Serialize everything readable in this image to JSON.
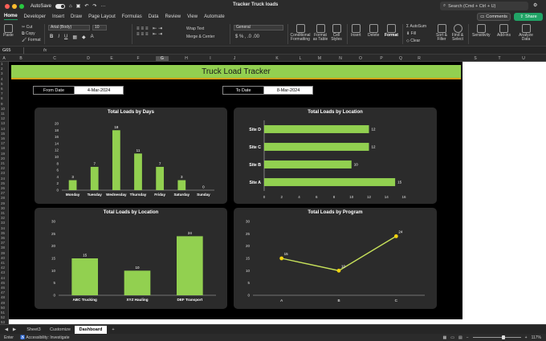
{
  "window": {
    "autosave_label": "AutoSave",
    "title": "Tracker Truck loads",
    "search_placeholder": "Search (Cmd + Ctrl + U)"
  },
  "menu_tabs": [
    "Home",
    "Developer",
    "Insert",
    "Draw",
    "Page Layout",
    "Formulas",
    "Data",
    "Review",
    "View",
    "Automate"
  ],
  "buttons": {
    "comments": "Comments",
    "share": "Share"
  },
  "ribbon": {
    "paste": "Paste",
    "cut": "Cut",
    "copy": "Copy",
    "format_painter": "Format",
    "font_name": "Arial (Body)",
    "font_size": "10",
    "wrap_text": "Wrap Text",
    "merge_center": "Merge & Center",
    "number_format": "General",
    "conditional_formatting": "Conditional Formatting",
    "format_as_table": "Format as Table",
    "cell_styles": "Cell Styles",
    "insert": "Insert",
    "delete": "Delete",
    "format": "Format",
    "autosum": "AutoSum",
    "fill": "Fill",
    "clear": "Clear",
    "sort_filter": "Sort & Filter",
    "find_select": "Find & Select",
    "sensitivity": "Sensitivity",
    "add_ins": "Add-ins",
    "analyze_data": "Analyze Data"
  },
  "formula_bar": {
    "name_box": "G65",
    "fx": "fx"
  },
  "columns": [
    "A",
    "B",
    "C",
    "D",
    "E",
    "F",
    "G",
    "H",
    "I",
    "J",
    "K",
    "L",
    "M",
    "N",
    "O",
    "P",
    "Q",
    "R",
    "S",
    "T",
    "U"
  ],
  "rows": [
    "1",
    "2",
    "3",
    "4",
    "5",
    "6",
    "7",
    "8",
    "9",
    "10",
    "11",
    "12",
    "13",
    "14",
    "15",
    "16",
    "17",
    "18",
    "19",
    "20",
    "21",
    "22",
    "23",
    "24",
    "25",
    "26",
    "27",
    "28",
    "29",
    "30",
    "31",
    "32",
    "33",
    "34",
    "35",
    "36",
    "37",
    "38",
    "39",
    "40",
    "41",
    "42",
    "43",
    "44",
    "45",
    "46",
    "47",
    "48",
    "49",
    "50",
    "51",
    "52",
    "53"
  ],
  "dashboard": {
    "title": "Truck Load Tracker",
    "from_label": "From Date",
    "from_value": "4-Mar-2024",
    "to_label": "To Date",
    "to_value": "8-Mar-2024"
  },
  "sheet_tabs": [
    "Sheet3",
    "Customize",
    "Dashboard"
  ],
  "active_sheet": "Dashboard",
  "status": {
    "mode": "Enter",
    "accessibility": "Accessibility: Investigate",
    "zoom": "117%"
  },
  "colors": {
    "bar": "#92d050",
    "line": "#c6e05a",
    "marker": "#f2d30f",
    "panel": "#2b2b2b",
    "banner": "#92d050"
  },
  "chart_data": [
    {
      "type": "bar",
      "title": "Total Loads by Days",
      "categories": [
        "Monday",
        "Tuesday",
        "Wednesday",
        "Thursday",
        "Friday",
        "Saturday",
        "Sunday"
      ],
      "values": [
        3,
        7,
        18,
        11,
        7,
        3,
        0
      ],
      "ylim": [
        0,
        20
      ],
      "yticks": [
        0,
        2,
        4,
        6,
        8,
        10,
        12,
        14,
        16,
        18,
        20
      ]
    },
    {
      "type": "bar",
      "orientation": "horizontal",
      "title": "Total Loads by Location",
      "categories": [
        "Site D",
        "Site C",
        "Site B",
        "Site A"
      ],
      "values": [
        12,
        12,
        10,
        15
      ],
      "xlim": [
        0,
        16
      ],
      "xticks": [
        0,
        2,
        4,
        6,
        8,
        10,
        12,
        14,
        16
      ]
    },
    {
      "type": "bar",
      "title": "Total Loads by Location",
      "categories": [
        "ABC Trucking",
        "XYZ Hauling",
        "DEF Transport"
      ],
      "values": [
        15,
        10,
        24
      ],
      "ylim": [
        0,
        30
      ],
      "yticks": [
        0,
        5,
        10,
        15,
        20,
        25,
        30
      ]
    },
    {
      "type": "line",
      "title": "Total Loads by Program",
      "categories": [
        "A",
        "B",
        "C"
      ],
      "values": [
        15,
        10,
        24
      ],
      "ylim": [
        0,
        30
      ],
      "yticks": [
        0,
        5,
        10,
        15,
        20,
        25,
        30
      ]
    }
  ]
}
